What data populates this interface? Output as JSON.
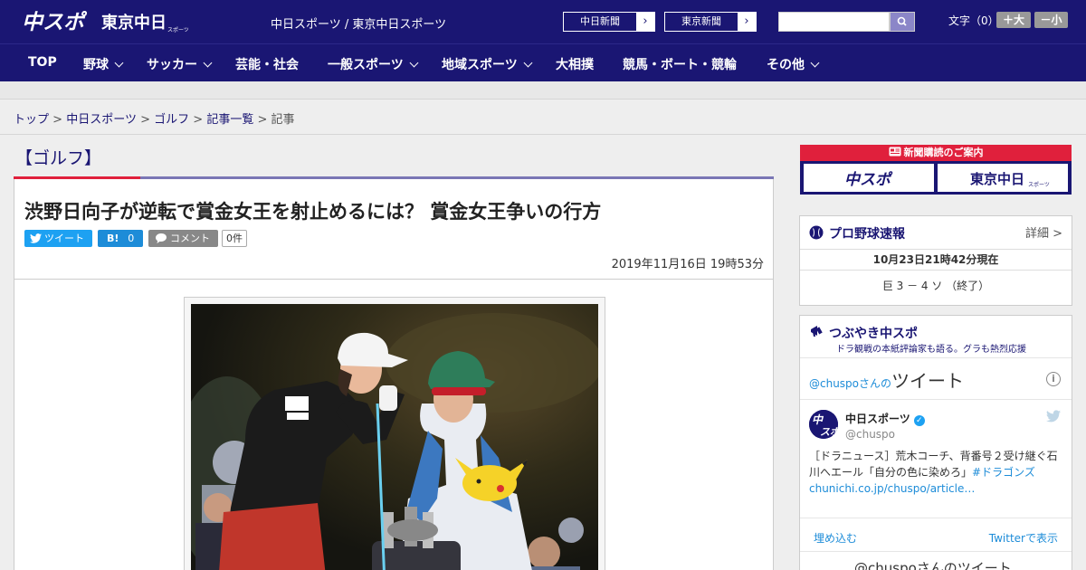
{
  "header": {
    "logo_chuspo": "中スポ",
    "logo_tokyo": "東京中日",
    "logo_tokyo_sub": "スポーツ",
    "site_name": "中日スポーツ / 東京中日スポーツ",
    "ext_links": [
      {
        "label": "中日新聞"
      },
      {
        "label": "東京新聞"
      }
    ],
    "search_placeholder": "",
    "font_size_label": "文字（0）",
    "font_increase": "＋大",
    "font_decrease": "－小"
  },
  "nav": {
    "items": [
      {
        "label": "TOP"
      },
      {
        "label": "野球"
      },
      {
        "label": "サッカー"
      },
      {
        "label": "芸能・社会"
      },
      {
        "label": "一般スポーツ"
      },
      {
        "label": "地域スポーツ"
      },
      {
        "label": "大相撲"
      },
      {
        "label": "競馬・ボート・競輪"
      },
      {
        "label": "その他"
      }
    ]
  },
  "breadcrumb": {
    "items": [
      "トップ",
      "中日スポーツ",
      "ゴルフ",
      "記事一覧"
    ],
    "current": "記事",
    "separator": ">"
  },
  "article": {
    "category": "【ゴルフ】",
    "headline": "渋野日向子が逆転で賞金女王を射止めるには？ 賞金女王争いの行方",
    "tweet_label": "ツイート",
    "hatena_label": "B!",
    "hatena_count": "0",
    "comment_label": "コメント",
    "comment_count": "0件",
    "date": "2019年11月16日 19時53分"
  },
  "sidebar": {
    "ad_title": "新聞購読のご案内",
    "ad_left": "中スポ",
    "ad_right": "東京中日",
    "ad_right_sub": "スポーツ",
    "baseball": {
      "title": "プロ野球速報",
      "detail": "詳細 >",
      "date": "10月23日21時42分現在",
      "score": "巨 3 － 4 ソ （終了）"
    },
    "twitter": {
      "title": "つぶやき中スポ",
      "subtitle": "ドラ観戦の本紙評論家も語る。グラも熱烈応援",
      "head_handle": "@chuspoさんの",
      "head_big": "ツイート",
      "name": "中日スポーツ",
      "handle": "@chuspo",
      "text_plain": "［ドラニュース］荒木コーチ、背番号２受け継ぐ石川へエール「自分の色に染めろ」",
      "text_hashtag": "#ドラゴンズ",
      "text_link": "chunichi.co.jp/chuspo/article…",
      "embed": "埋め込む",
      "view": "Twitterで表示",
      "footer": "@chuspoさんのツイート"
    }
  },
  "colors": {
    "brand_navy": "#1a1673",
    "accent_red": "#e0203c",
    "twitter_blue": "#1da1f2"
  }
}
